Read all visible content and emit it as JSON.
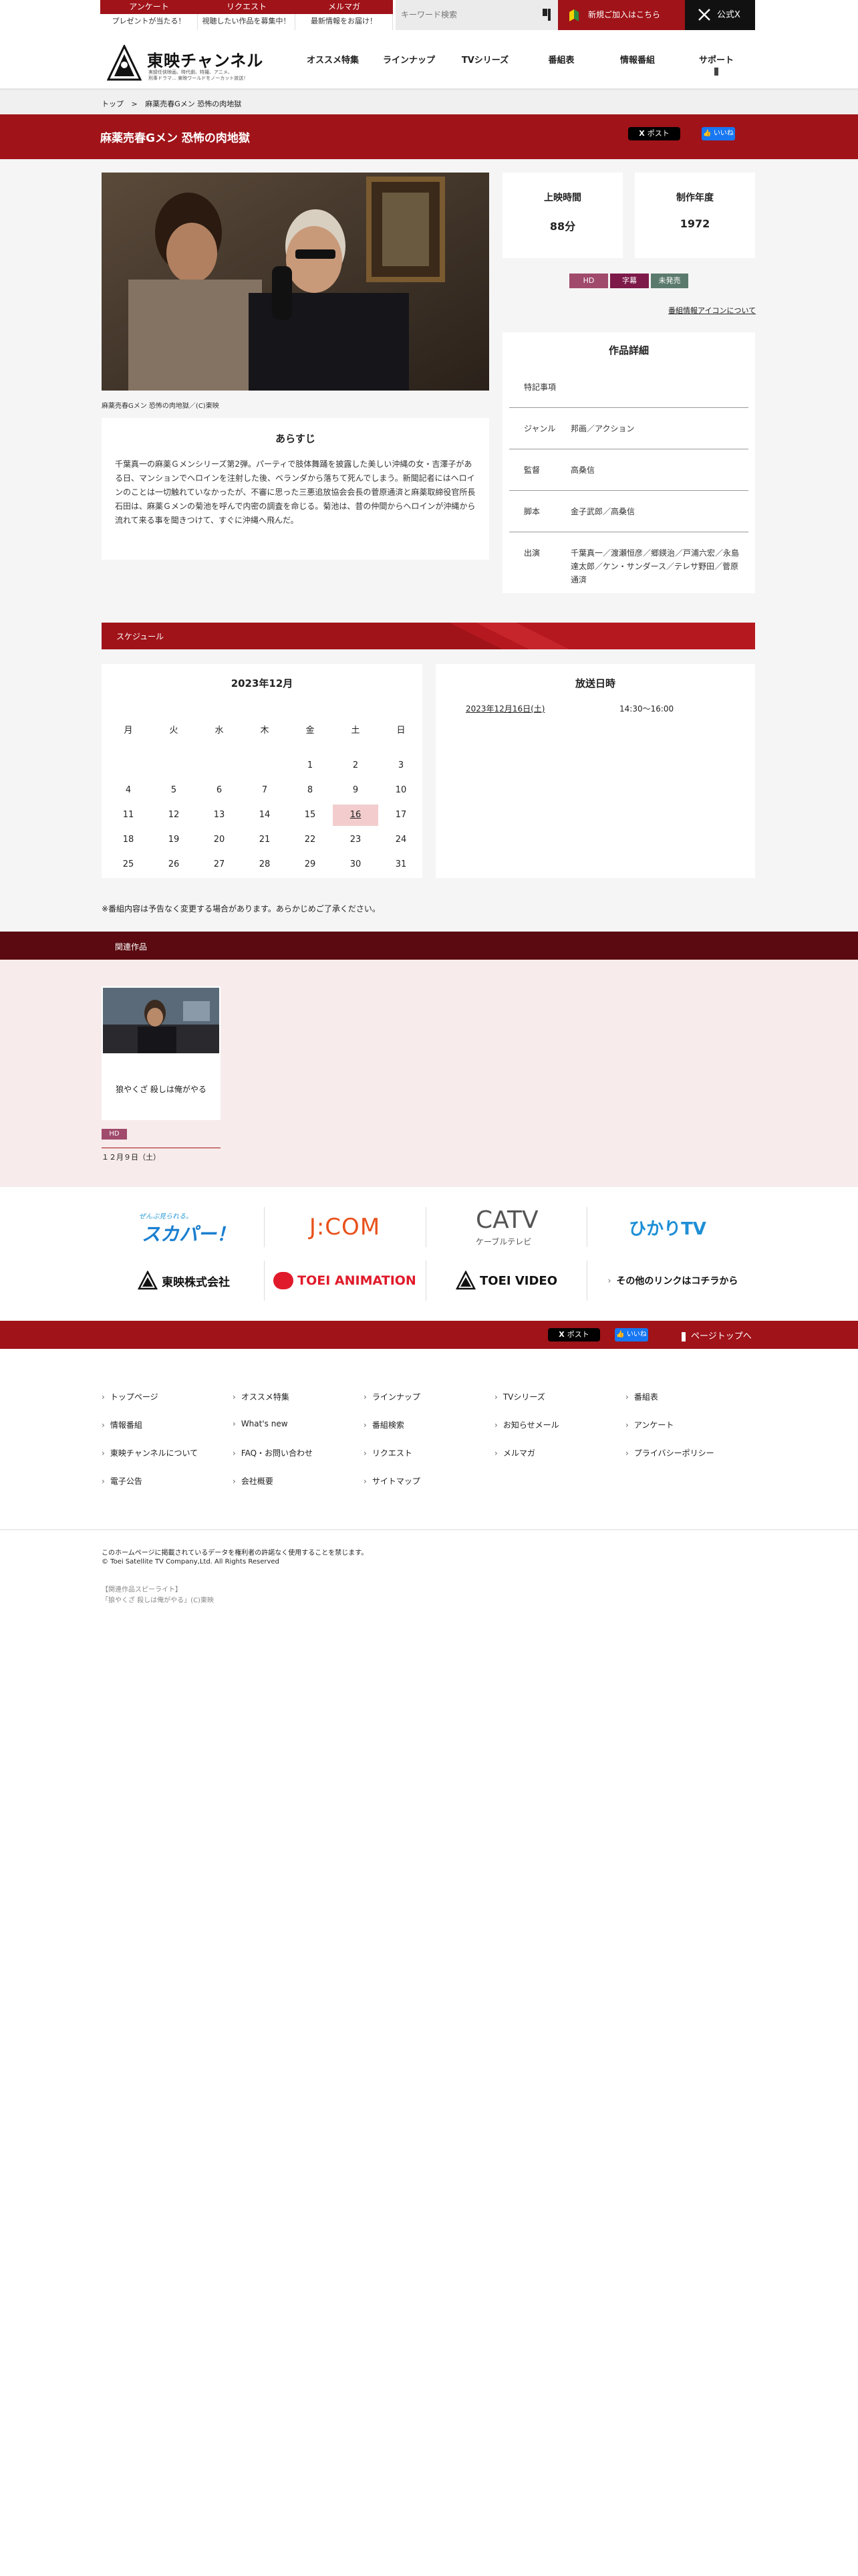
{
  "topbar": {
    "items": [
      {
        "head": "アンケート",
        "sub": "プレゼントが当たる！"
      },
      {
        "head": "リクエスト",
        "sub": "視聴したい作品を募集中！"
      },
      {
        "head": "メルマガ",
        "sub": "最新情報をお届け！"
      }
    ],
    "search_placeholder": "キーワード検索",
    "new_join": "新規ご加入はこちら",
    "x_official": "公式X"
  },
  "logo": {
    "name": "東映チャンネル",
    "tagline1": "実録任俠映画、時代劇、特撮、アニメ、",
    "tagline2": "刑事ドラマ… 東映ワールドをノーカット放送！"
  },
  "nav": [
    "オススメ特集",
    "ラインナップ",
    "TVシリーズ",
    "番組表",
    "情報番組",
    "サポート"
  ],
  "breadcrumb": {
    "home": "トップ",
    "sep": ">",
    "current": "麻薬売春Gメン 恐怖の肉地獄"
  },
  "title": "麻薬売春Gメン 恐怖の肉地獄",
  "share": {
    "xpost": "ポスト",
    "like": "いいね"
  },
  "photo_caption": "麻薬売春Gメン 恐怖の肉地獄／(C)東映",
  "synopsis": {
    "heading": "あらすじ",
    "text": "千葉真一の麻薬Ｇメンシリーズ第2弾。パーティで肢体舞踊を披露した美しい沖縄の女・吉澤子がある日、マンションでヘロインを注射した後、ベランダから落ちて死んでしまう。新聞記者にはヘロインのことは一切触れていなかったが、不審に思った三悪追放協会会長の菅原通済と麻薬取締役官所長石田は、麻薬Ｇメンの菊池を呼んで内密の調査を命じる。菊池は、昔の仲間からヘロインが沖縄から流れて来る事を聞きつけて、すぐに沖縄へ飛んだ。"
  },
  "stats": [
    {
      "label": "上映時間",
      "value": "88分"
    },
    {
      "label": "制作年度",
      "value": "1972"
    }
  ],
  "badges": [
    "HD",
    "字幕",
    "未発売"
  ],
  "icon_link": "番組情報アイコンについて",
  "detail": {
    "heading": "作品詳細",
    "rows": [
      {
        "key": "特記事項",
        "value": ""
      },
      {
        "key": "ジャンル",
        "value": "邦画／アクション"
      },
      {
        "key": "監督",
        "value": "高桑信"
      },
      {
        "key": "脚本",
        "value": "金子武郎／高桑信"
      },
      {
        "key": "出演",
        "value": "千葉真一／渡瀬恒彦／郷鍈治／戸浦六宏／永島達太郎／ケン・サンダース／テレサ野田／菅原通済"
      }
    ]
  },
  "schedule": {
    "heading": "スケジュール",
    "month": "2023年12月",
    "weekdays": [
      "月",
      "火",
      "水",
      "木",
      "金",
      "土",
      "日"
    ],
    "days": [
      "1",
      "2",
      "3",
      "4",
      "5",
      "6",
      "7",
      "8",
      "9",
      "10",
      "11",
      "12",
      "13",
      "14",
      "15",
      "16",
      "17",
      "18",
      "19",
      "20",
      "21",
      "22",
      "23",
      "24",
      "25",
      "26",
      "27",
      "28",
      "29",
      "30",
      "31"
    ],
    "air_heading": "放送日時",
    "air_date": "2023年12月16日(土)",
    "air_time": "14:30〜16:00",
    "notice": "※番組内容は予告なく変更する場合があります。あらかじめご了承ください。"
  },
  "related": {
    "heading": "関連作品",
    "title": "狼やくざ 殺しは俺がやる",
    "badge": "HD",
    "date": "１２月９日（土）"
  },
  "partners": {
    "skyperfect": "スカパー！",
    "skyperfect_sub": "ぜんぶ見られる。",
    "jcom": "J:COM",
    "catv": "CATV",
    "catv_sub": "ケーブルテレビ",
    "hikari": "ひかりTV",
    "toei": "東映株式会社",
    "toei_anim": "TOEI ANIMATION",
    "toei_video": "TOEI VIDEO",
    "other": "その他のリンクはコチラから"
  },
  "footer": {
    "pagetop": "ページトップへ",
    "links": [
      [
        "トップページ",
        "オススメ特集",
        "ラインナップ",
        "TVシリーズ",
        "番組表"
      ],
      [
        "情報番組",
        "What's new",
        "番組検索",
        "お知らせメール",
        "アンケート"
      ],
      [
        "東映チャンネルについて",
        "FAQ・お問い合わせ",
        "リクエスト",
        "メルマガ",
        "プライバシーポリシー"
      ],
      [
        "電子公告",
        "会社概要",
        "サイトマップ"
      ]
    ],
    "copy1": "このホームページに掲載されているデータを権利者の許諾なく使用することを禁じます。",
    "copy2": "© Toei Satellite TV Company,Ltd. All Rights Reserved",
    "credit1": "【関連作品スピーライト】",
    "credit2": "「狼やくざ 殺しは俺がやる」(C)東映"
  },
  "colors": {
    "brand_red": "#a01319",
    "dark_red": "#5a0a10",
    "badge_hd": "#a04a6c",
    "badge_sub": "#7d1a4a",
    "badge_unreleased": "#5b7a6e"
  }
}
